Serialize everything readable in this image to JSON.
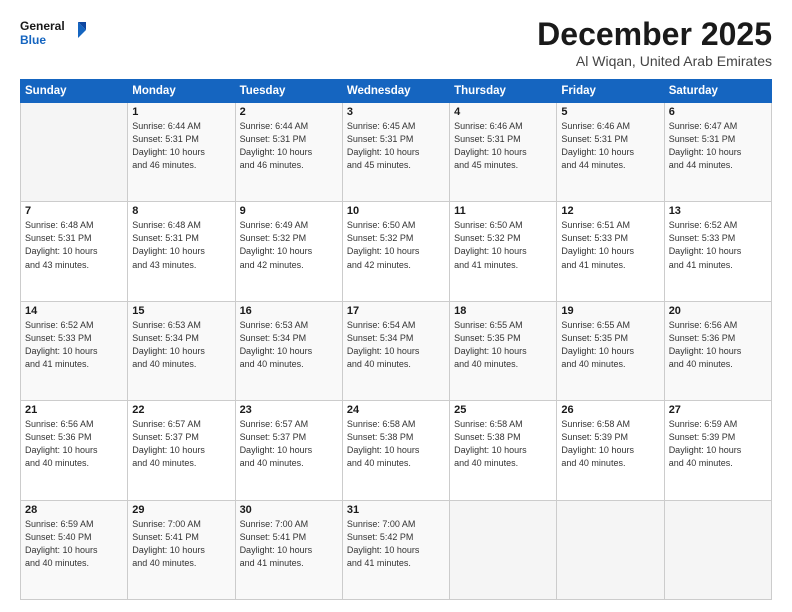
{
  "header": {
    "logo_line1": "General",
    "logo_line2": "Blue",
    "month": "December 2025",
    "location": "Al Wiqan, United Arab Emirates"
  },
  "weekdays": [
    "Sunday",
    "Monday",
    "Tuesday",
    "Wednesday",
    "Thursday",
    "Friday",
    "Saturday"
  ],
  "weeks": [
    [
      {
        "day": "",
        "info": ""
      },
      {
        "day": "1",
        "info": "Sunrise: 6:44 AM\nSunset: 5:31 PM\nDaylight: 10 hours\nand 46 minutes."
      },
      {
        "day": "2",
        "info": "Sunrise: 6:44 AM\nSunset: 5:31 PM\nDaylight: 10 hours\nand 46 minutes."
      },
      {
        "day": "3",
        "info": "Sunrise: 6:45 AM\nSunset: 5:31 PM\nDaylight: 10 hours\nand 45 minutes."
      },
      {
        "day": "4",
        "info": "Sunrise: 6:46 AM\nSunset: 5:31 PM\nDaylight: 10 hours\nand 45 minutes."
      },
      {
        "day": "5",
        "info": "Sunrise: 6:46 AM\nSunset: 5:31 PM\nDaylight: 10 hours\nand 44 minutes."
      },
      {
        "day": "6",
        "info": "Sunrise: 6:47 AM\nSunset: 5:31 PM\nDaylight: 10 hours\nand 44 minutes."
      }
    ],
    [
      {
        "day": "7",
        "info": "Sunrise: 6:48 AM\nSunset: 5:31 PM\nDaylight: 10 hours\nand 43 minutes."
      },
      {
        "day": "8",
        "info": "Sunrise: 6:48 AM\nSunset: 5:31 PM\nDaylight: 10 hours\nand 43 minutes."
      },
      {
        "day": "9",
        "info": "Sunrise: 6:49 AM\nSunset: 5:32 PM\nDaylight: 10 hours\nand 42 minutes."
      },
      {
        "day": "10",
        "info": "Sunrise: 6:50 AM\nSunset: 5:32 PM\nDaylight: 10 hours\nand 42 minutes."
      },
      {
        "day": "11",
        "info": "Sunrise: 6:50 AM\nSunset: 5:32 PM\nDaylight: 10 hours\nand 41 minutes."
      },
      {
        "day": "12",
        "info": "Sunrise: 6:51 AM\nSunset: 5:33 PM\nDaylight: 10 hours\nand 41 minutes."
      },
      {
        "day": "13",
        "info": "Sunrise: 6:52 AM\nSunset: 5:33 PM\nDaylight: 10 hours\nand 41 minutes."
      }
    ],
    [
      {
        "day": "14",
        "info": "Sunrise: 6:52 AM\nSunset: 5:33 PM\nDaylight: 10 hours\nand 41 minutes."
      },
      {
        "day": "15",
        "info": "Sunrise: 6:53 AM\nSunset: 5:34 PM\nDaylight: 10 hours\nand 40 minutes."
      },
      {
        "day": "16",
        "info": "Sunrise: 6:53 AM\nSunset: 5:34 PM\nDaylight: 10 hours\nand 40 minutes."
      },
      {
        "day": "17",
        "info": "Sunrise: 6:54 AM\nSunset: 5:34 PM\nDaylight: 10 hours\nand 40 minutes."
      },
      {
        "day": "18",
        "info": "Sunrise: 6:55 AM\nSunset: 5:35 PM\nDaylight: 10 hours\nand 40 minutes."
      },
      {
        "day": "19",
        "info": "Sunrise: 6:55 AM\nSunset: 5:35 PM\nDaylight: 10 hours\nand 40 minutes."
      },
      {
        "day": "20",
        "info": "Sunrise: 6:56 AM\nSunset: 5:36 PM\nDaylight: 10 hours\nand 40 minutes."
      }
    ],
    [
      {
        "day": "21",
        "info": "Sunrise: 6:56 AM\nSunset: 5:36 PM\nDaylight: 10 hours\nand 40 minutes."
      },
      {
        "day": "22",
        "info": "Sunrise: 6:57 AM\nSunset: 5:37 PM\nDaylight: 10 hours\nand 40 minutes."
      },
      {
        "day": "23",
        "info": "Sunrise: 6:57 AM\nSunset: 5:37 PM\nDaylight: 10 hours\nand 40 minutes."
      },
      {
        "day": "24",
        "info": "Sunrise: 6:58 AM\nSunset: 5:38 PM\nDaylight: 10 hours\nand 40 minutes."
      },
      {
        "day": "25",
        "info": "Sunrise: 6:58 AM\nSunset: 5:38 PM\nDaylight: 10 hours\nand 40 minutes."
      },
      {
        "day": "26",
        "info": "Sunrise: 6:58 AM\nSunset: 5:39 PM\nDaylight: 10 hours\nand 40 minutes."
      },
      {
        "day": "27",
        "info": "Sunrise: 6:59 AM\nSunset: 5:39 PM\nDaylight: 10 hours\nand 40 minutes."
      }
    ],
    [
      {
        "day": "28",
        "info": "Sunrise: 6:59 AM\nSunset: 5:40 PM\nDaylight: 10 hours\nand 40 minutes."
      },
      {
        "day": "29",
        "info": "Sunrise: 7:00 AM\nSunset: 5:41 PM\nDaylight: 10 hours\nand 40 minutes."
      },
      {
        "day": "30",
        "info": "Sunrise: 7:00 AM\nSunset: 5:41 PM\nDaylight: 10 hours\nand 41 minutes."
      },
      {
        "day": "31",
        "info": "Sunrise: 7:00 AM\nSunset: 5:42 PM\nDaylight: 10 hours\nand 41 minutes."
      },
      {
        "day": "",
        "info": ""
      },
      {
        "day": "",
        "info": ""
      },
      {
        "day": "",
        "info": ""
      }
    ]
  ]
}
